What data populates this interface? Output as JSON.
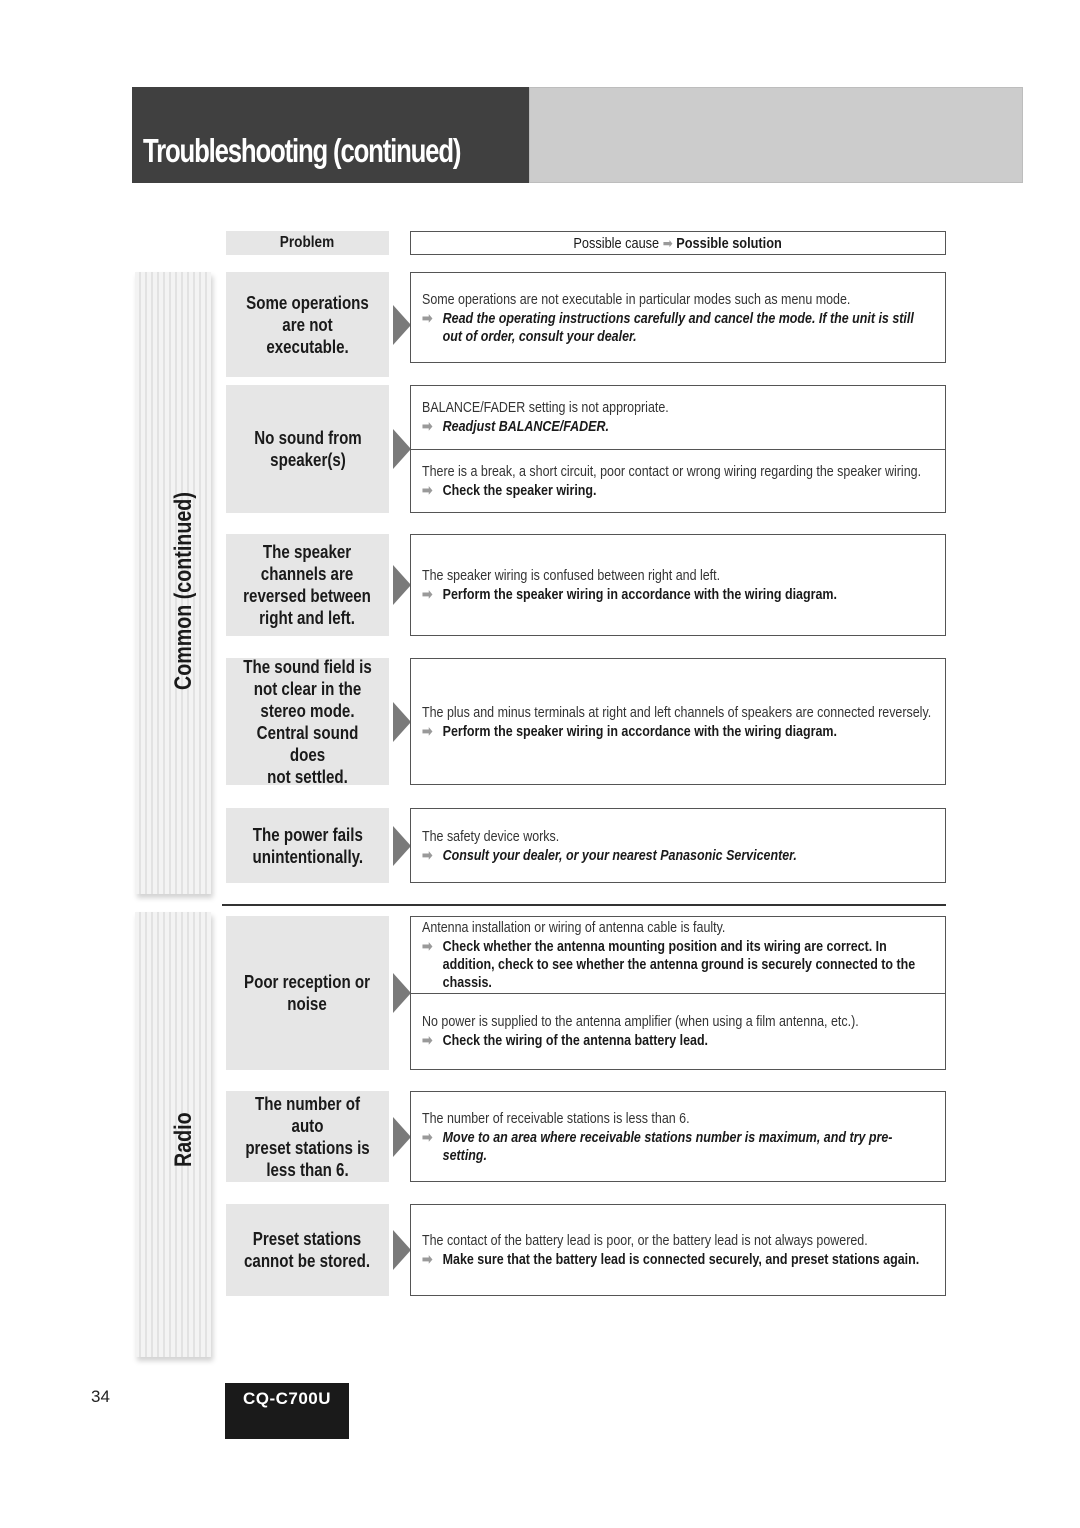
{
  "header": {
    "title": "Troubleshooting (continued)"
  },
  "columns": {
    "problem": "Problem",
    "cause_prefix": "Possible cause",
    "cause_arrow": "➡",
    "solution_label": "Possible solution"
  },
  "sections": {
    "common": {
      "label": "Common (continued)"
    },
    "radio": {
      "label": "Radio"
    }
  },
  "rows": [
    {
      "problem": "Some operations\nare not executable.",
      "causes": [
        {
          "cause": "Some operations are not executable in particular modes such as menu mode.",
          "solution": "Read the operating instructions carefully and cancel the mode. If the unit is still out of order, consult your dealer.",
          "italic": true
        }
      ]
    },
    {
      "problem": "No sound from\nspeaker(s)",
      "causes": [
        {
          "cause": "BALANCE/FADER setting is not appropriate.",
          "solution": "Readjust BALANCE/FADER.",
          "italic": true
        },
        {
          "cause": "There is a break, a short circuit, poor contact or wrong wiring regarding the speaker wiring.",
          "solution": "Check the speaker wiring.",
          "italic": false
        }
      ]
    },
    {
      "problem": "The speaker\nchannels are\nreversed between\nright and left.",
      "causes": [
        {
          "cause": "The speaker wiring is confused between right and left.",
          "solution": "Perform the speaker wiring in accordance with the wiring diagram.",
          "italic": false
        }
      ]
    },
    {
      "problem": "The sound field is\nnot clear in the\nstereo mode.\nCentral sound does\nnot settled.",
      "causes": [
        {
          "cause": "The plus and minus terminals at right and left channels of speakers are connected reversely.",
          "solution": "Perform the speaker wiring in accordance with the wiring diagram.",
          "italic": false
        }
      ]
    },
    {
      "problem": "The power fails\nunintentionally.",
      "causes": [
        {
          "cause": "The safety device works.",
          "solution": "Consult your dealer, or your nearest Panasonic Servicenter.",
          "italic": true
        }
      ]
    },
    {
      "problem": "Poor reception or\nnoise",
      "causes": [
        {
          "cause": "Antenna installation or wiring of antenna cable is faulty.",
          "solution": "Check whether the antenna mounting position and its wiring are correct. In addition, check to see whether the antenna ground is securely connected to the chassis.",
          "italic": false
        },
        {
          "cause": "No power is supplied to the antenna amplifier (when using a film antenna, etc.).",
          "solution": "Check the wiring of the antenna battery lead.",
          "italic": false
        }
      ]
    },
    {
      "problem": "The number of auto\npreset stations is\nless than 6.",
      "causes": [
        {
          "cause": "The number of receivable stations is less than 6.",
          "solution": "Move to an area where receivable stations number is maximum, and try pre-setting.",
          "italic": true
        }
      ]
    },
    {
      "problem": "Preset stations\ncannot be stored.",
      "causes": [
        {
          "cause": "The contact of the battery lead is poor, or the battery lead is not always powered.",
          "solution": "Make sure that the battery lead is connected securely, and preset stations again.",
          "italic": false
        }
      ]
    }
  ],
  "footer": {
    "page_number": "34",
    "model": "CQ-C700U"
  }
}
